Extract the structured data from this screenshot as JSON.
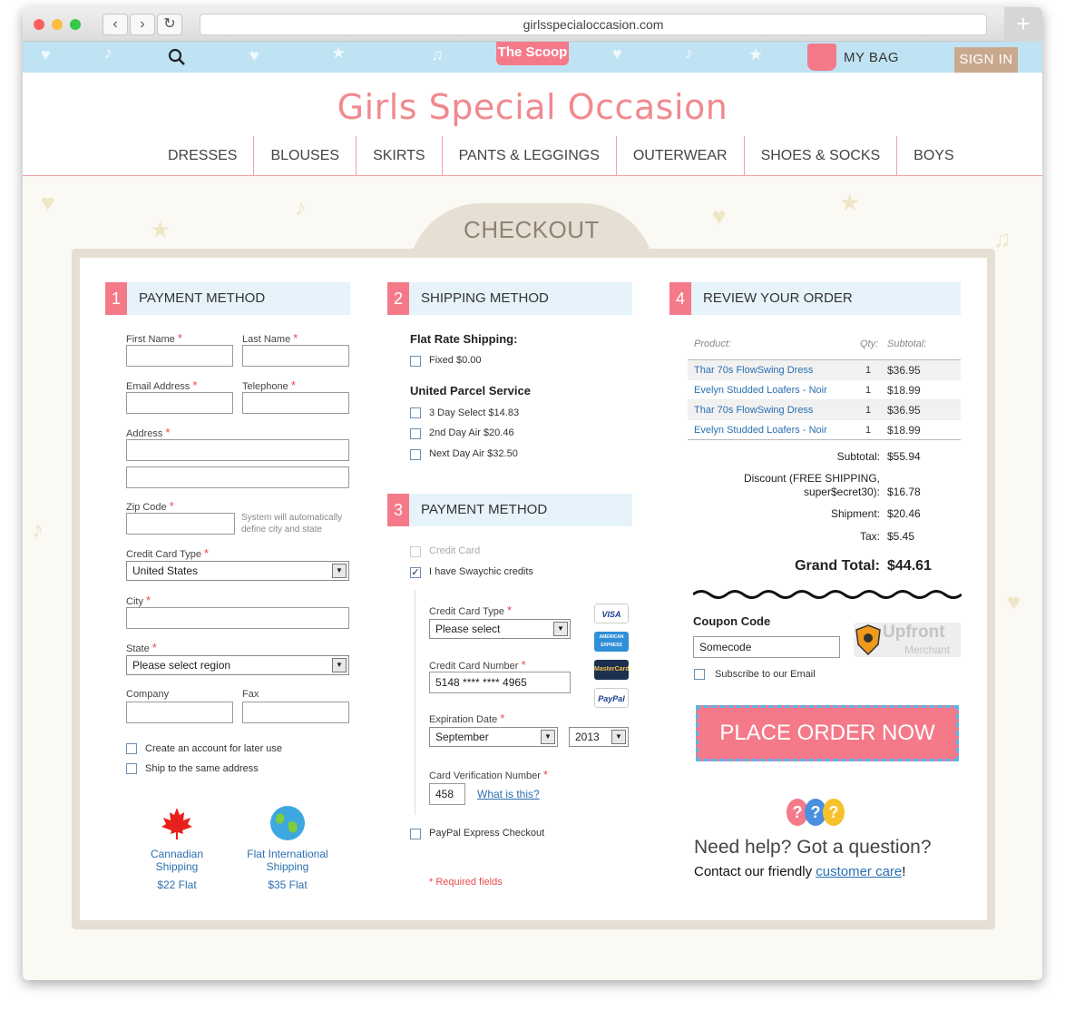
{
  "browser": {
    "url": "girlsspecialoccasion.com",
    "back": "‹",
    "forward": "›",
    "reload": "↻",
    "new_tab": "+"
  },
  "topbar": {
    "scoop": "The Scoop",
    "my_bag": "MY BAG",
    "sign_in": "SIGN IN"
  },
  "site": {
    "logo": "Girls Special Occasion"
  },
  "nav": [
    "DRESSES",
    "BLOUSES",
    "SKIRTS",
    "PANTS & LEGGINGS",
    "OUTERWEAR",
    "SHOES & SOCKS",
    "BOYS"
  ],
  "checkout": {
    "title": "CHECKOUT"
  },
  "section1": {
    "num": "1",
    "title": "PAYMENT METHOD",
    "first_name": "First Name",
    "last_name": "Last Name",
    "email": "Email Address",
    "telephone": "Telephone",
    "address": "Address",
    "zip": "Zip Code",
    "zip_note1": "System will automatically",
    "zip_note2": "define city and state",
    "cc_type": "Credit Card Type",
    "cc_type_value": "United States",
    "city": "City",
    "state": "State",
    "state_value": "Please select region",
    "company": "Company",
    "fax": "Fax",
    "create_account": "Create an account for later use",
    "ship_same": "Ship to the same address",
    "ca_line1": "Cannadian",
    "ca_line2": "Shipping",
    "ca_price": "$22 Flat",
    "intl_line1": "Flat International",
    "intl_line2": "Shipping",
    "intl_price": "$35 Flat"
  },
  "section2": {
    "num": "2",
    "title": "SHIPPING METHOD",
    "flat_title": "Flat Rate Shipping:",
    "fixed": "Fixed $0.00",
    "ups_title": "United Parcel Service",
    "ups1": "3 Day Select $14.83",
    "ups2": "2nd Day Air $20.46",
    "ups3": "Next Day Air $32.50"
  },
  "section3": {
    "num": "3",
    "title": "PAYMENT METHOD",
    "credit_card": "Credit Card",
    "swaychic": "I have Swaychic credits",
    "cc_type": "Credit Card Type",
    "cc_type_value": "Please select",
    "cc_number": "Credit Card Number",
    "cc_number_value": "5148 **** **** 4965",
    "exp": "Expiration Date",
    "exp_month": "September",
    "exp_year": "2013",
    "cvv": "Card Verification Number",
    "cvv_value": "458",
    "what_is": "What is this?",
    "paypal_express": "PayPal Express Checkout",
    "required": "* Required fields",
    "cards": {
      "visa": "VISA",
      "amex": "AMERICAN EXPRESS",
      "mc": "MasterCard",
      "paypal": "PayPal"
    },
    "check": "✓"
  },
  "section4": {
    "num": "4",
    "title": "REVIEW YOUR ORDER",
    "col_product": "Product:",
    "col_qty": "Qty:",
    "col_subtotal": "Subtotal:",
    "items": [
      {
        "name": "Thar 70s FlowSwing Dress",
        "qty": "1",
        "price": "$36.95"
      },
      {
        "name": "Evelyn Studded Loafers - Noir",
        "qty": "1",
        "price": "$18.99"
      },
      {
        "name": "Thar 70s FlowSwing Dress",
        "qty": "1",
        "price": "$36.95"
      },
      {
        "name": "Evelyn Studded Loafers - Noir",
        "qty": "1",
        "price": "$18.99"
      }
    ],
    "subtotal_label": "Subtotal:",
    "subtotal": "$55.94",
    "discount_label1": "Discount (FREE SHIPPING,",
    "discount_label2": "super$ecret30):",
    "discount": "$16.78",
    "shipment_label": "Shipment:",
    "shipment": "$20.46",
    "tax_label": "Tax:",
    "tax": "$5.45",
    "grand_label": "Grand Total:",
    "grand": "$44.61",
    "coupon_label": "Coupon Code",
    "coupon_value": "Somecode",
    "upfront": "Upfront",
    "merchant": "Merchant",
    "subscribe": "Subscribe to our Email",
    "place_order": "PLACE ORDER NOW",
    "help_title": "Need help? Got a question?",
    "help_text": "Contact our friendly ",
    "help_link": "customer care",
    "help_end": "!"
  },
  "colors": {
    "accent": "#f47a8a",
    "link": "#2a6fb0",
    "tab": "#e6dfd3",
    "section_bg": "#e6f3fb"
  }
}
